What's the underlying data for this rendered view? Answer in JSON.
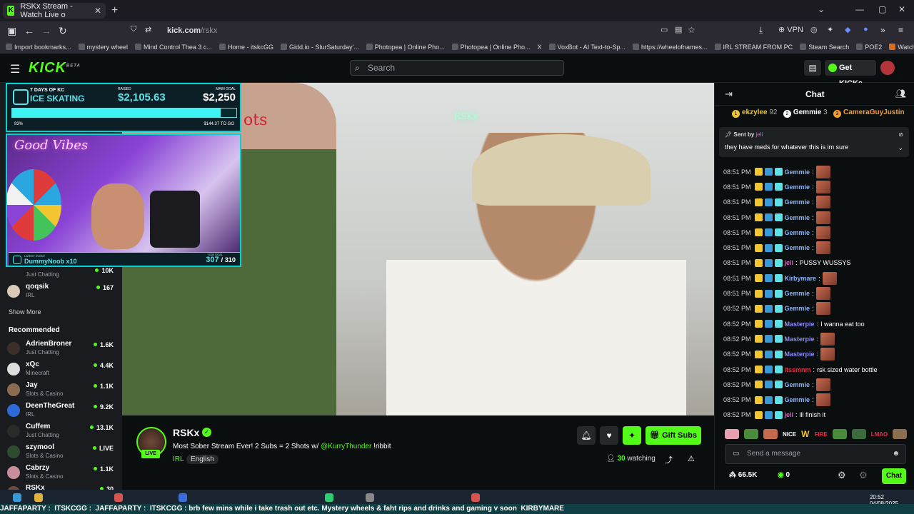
{
  "browser": {
    "tab_title": "RSKx Stream - Watch Live o",
    "url_domain": "kick.com",
    "url_path": "/rskx",
    "vpn_label": "VPN",
    "bookmarks": [
      "Import bookmarks...",
      "mystery wheel",
      "Mind Control Thea 3 c...",
      "Home - itskcGG",
      "Gidd.io - SlurSaturday'...",
      "Photopea | Online Pho...",
      "Photopea | Online Pho...",
      "X",
      "VoxBot - AI Text-to-Sp...",
      "https://wheelofnames...",
      "IRL STREAM FROM PC",
      "Steam Search",
      "POE2",
      "Watch Supernatural - ..."
    ]
  },
  "header": {
    "logo": "KICK",
    "logo_beta": "BETA",
    "search_placeholder": "Search",
    "get_kicks": "Get KICKs"
  },
  "sidebar": {
    "following_partial": {
      "category": "Just Chatting",
      "viewers": "10K"
    },
    "following": [
      {
        "name": "qoqsik",
        "category": "IRL",
        "viewers": "167"
      }
    ],
    "show_more": "Show More",
    "recommended_heading": "Recommended",
    "recommended": [
      {
        "name": "AdrienBroner",
        "category": "Just Chatting",
        "viewers": "1.6K"
      },
      {
        "name": "xQc",
        "category": "Minecraft",
        "viewers": "4.4K"
      },
      {
        "name": "Jay",
        "category": "Slots & Casino",
        "viewers": "1.1K"
      },
      {
        "name": "DeenTheGreat",
        "category": "IRL",
        "viewers": "9.2K"
      },
      {
        "name": "Cuffem",
        "category": "Just Chatting",
        "viewers": "13.1K"
      },
      {
        "name": "szymool",
        "category": "Slots & Casino",
        "viewers": "LIVE"
      },
      {
        "name": "Cabrzy",
        "category": "Slots & Casino",
        "viewers": "1.1K"
      },
      {
        "name": "RSKx",
        "category": "",
        "viewers": "30"
      }
    ]
  },
  "overlay": {
    "goal_line1": "7 DAYS OF KC",
    "goal_line2": "ICE SKATING",
    "raised_label": "RAISED",
    "raised_value": "$2,105.63",
    "main_goal_label": "MAIN GOAL",
    "main_goal_value": "$2,250",
    "progress_fraction": 0.93,
    "progress_pct": "93%",
    "to_go": "$144.37 TO GO",
    "good_vibes": "Good Vibes",
    "latest_event_label": "LATEST EVENT",
    "latest_event": "DummyNoob x10",
    "sub_goal_label": "SUB GOAL",
    "subs_current": "307",
    "subs_total": "/ 310",
    "neon_sign": "RSKx",
    "wall_text": "ots"
  },
  "stream": {
    "channel": "RSKx",
    "live": "LIVE",
    "title_prefix": "Most Sober Stream Ever! 2 Subs = 2 Shots w/ ",
    "title_mention": "@KurryThunder",
    "title_suffix": " !ribbit",
    "category": "IRL",
    "language": "English",
    "gift_subs": "Gift Subs",
    "watching_count": "30",
    "watching_label": "watching"
  },
  "chat": {
    "title": "Chat",
    "leaderboard": [
      {
        "rank": "1",
        "name": "ekzylee",
        "count": "92",
        "color": "#f2c531"
      },
      {
        "rank": "2",
        "name": "Gemmie",
        "count": "3",
        "color": "#ffffff"
      },
      {
        "rank": "3",
        "name": "CameraGuyJustin",
        "count": "",
        "color": "#f29d31"
      }
    ],
    "pinned_by_label": "Sent by",
    "pinned_user": "jeli",
    "pinned_message": "they have meds for whatever this is im sure",
    "messages": [
      {
        "time": "08:51 PM",
        "user": "Gemmie",
        "color": "#8ab4f8",
        "text": ""
      },
      {
        "time": "08:51 PM",
        "user": "Gemmie",
        "color": "#8ab4f8",
        "text": ""
      },
      {
        "time": "08:51 PM",
        "user": "Gemmie",
        "color": "#8ab4f8",
        "text": ""
      },
      {
        "time": "08:51 PM",
        "user": "Gemmie",
        "color": "#8ab4f8",
        "text": ""
      },
      {
        "time": "08:51 PM",
        "user": "Gemmie",
        "color": "#8ab4f8",
        "text": ""
      },
      {
        "time": "08:51 PM",
        "user": "Gemmie",
        "color": "#8ab4f8",
        "text": ""
      },
      {
        "time": "08:51 PM",
        "user": "jeli",
        "color": "#e05bd3",
        "text": "PUSSY WUSSYS"
      },
      {
        "time": "08:51 PM",
        "user": "Kirbymare",
        "color": "#8ab4f8",
        "text": ""
      },
      {
        "time": "08:51 PM",
        "user": "Gemmie",
        "color": "#8ab4f8",
        "text": ""
      },
      {
        "time": "08:52 PM",
        "user": "Gemmie",
        "color": "#8ab4f8",
        "text": ""
      },
      {
        "time": "08:52 PM",
        "user": "Masterpie",
        "color": "#8a8cf8",
        "text": "I wanna eat too"
      },
      {
        "time": "08:52 PM",
        "user": "Masterpie",
        "color": "#8a8cf8",
        "text": ""
      },
      {
        "time": "08:52 PM",
        "user": "Masterpie",
        "color": "#8a8cf8",
        "text": ""
      },
      {
        "time": "08:52 PM",
        "user": "itssmnm",
        "color": "#e0314c",
        "text": "rsk sized water bottle"
      },
      {
        "time": "08:52 PM",
        "user": "Gemmie",
        "color": "#8ab4f8",
        "text": ""
      },
      {
        "time": "08:52 PM",
        "user": "Gemmie",
        "color": "#8ab4f8",
        "text": ""
      },
      {
        "time": "08:52 PM",
        "user": "jeli",
        "color": "#e05bd3",
        "text": "ill finish it"
      }
    ],
    "emote_nice": "NICE",
    "emote_fire": "FIRE",
    "emote_w": "W",
    "emote_lmao": "LMAO",
    "input_placeholder": "Send a message",
    "points": "66.5K",
    "kicks": "0",
    "send_button": "Chat"
  },
  "taskbar": {
    "ticker": "JAFFAPARTY :  ITSKCGG :  JAFFAPARTY :  ITSKCGG : brb few mins while i take trash out etc. Mystery wheels & faht rips and drinks and gaming v soon  KIRBYMARE",
    "clock_time": "20:52",
    "clock_date": "04/08/2025"
  },
  "colors": {
    "kick_green": "#53fc18",
    "overlay_cyan": "#5ce1e6"
  }
}
